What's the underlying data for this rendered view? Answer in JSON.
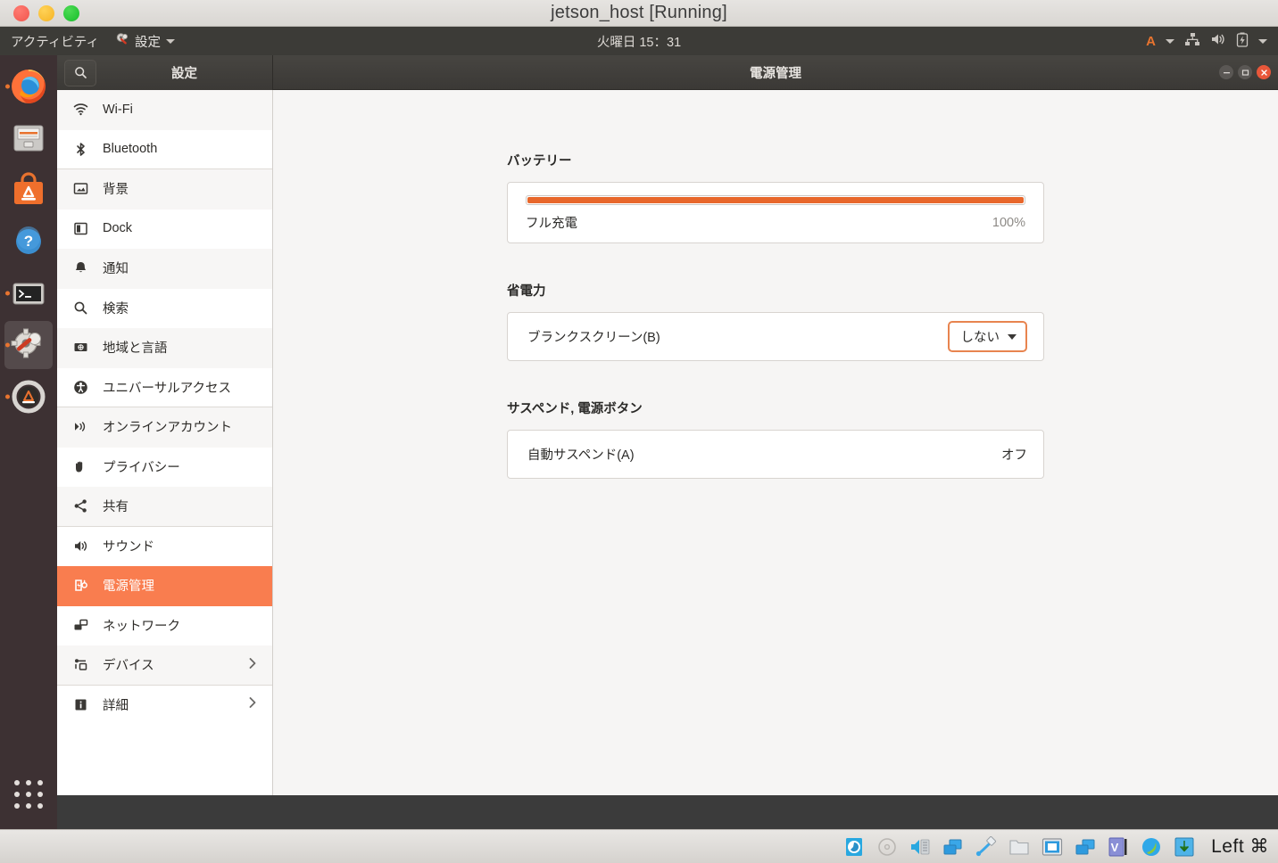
{
  "vm": {
    "title": "jetson_host [Running]",
    "statusbar": {
      "icons": [
        "hard-disk-icon",
        "optical-disk-icon",
        "audio-icon",
        "network-icon",
        "usb-icon",
        "shared-folder-icon",
        "display-icon",
        "recording-icon",
        "virtualbox-logo-icon",
        "updates-icon"
      ],
      "host_key": "Left ⌘"
    },
    "window_controls": [
      "minimize",
      "maximize",
      "close"
    ]
  },
  "topbar": {
    "activities": "アクティビティ",
    "app_name": "設定",
    "clock": "火曜日 15：31",
    "indicators": {
      "input_source": "A",
      "icons": [
        "network-icon",
        "volume-icon",
        "battery-charging-icon"
      ]
    }
  },
  "dock": {
    "items": [
      {
        "name": "firefox",
        "running": true,
        "active": false
      },
      {
        "name": "files",
        "running": false,
        "active": false
      },
      {
        "name": "ubuntu-software",
        "running": false,
        "active": false
      },
      {
        "name": "help",
        "running": false,
        "active": false
      },
      {
        "name": "terminal",
        "running": true,
        "active": false
      },
      {
        "name": "settings",
        "running": true,
        "active": true
      },
      {
        "name": "software-updater",
        "running": true,
        "active": false
      }
    ],
    "show_apps_label": "show-applications"
  },
  "settings": {
    "sidebar_title": "設定",
    "page_title": "電源管理",
    "search_placeholder": "検索",
    "items": [
      {
        "label": "Wi-Fi",
        "icon": "wifi-icon",
        "key": "wifi",
        "alt": true,
        "sep": false,
        "chevron": false,
        "selected": false
      },
      {
        "label": "Bluetooth",
        "icon": "bluetooth-icon",
        "key": "bluetooth",
        "alt": false,
        "sep": true,
        "chevron": false,
        "selected": false
      },
      {
        "label": "背景",
        "icon": "background-icon",
        "key": "background",
        "alt": true,
        "sep": false,
        "chevron": false,
        "selected": false
      },
      {
        "label": "Dock",
        "icon": "dock-icon",
        "key": "dock",
        "alt": false,
        "sep": false,
        "chevron": false,
        "selected": false
      },
      {
        "label": "通知",
        "icon": "bell-icon",
        "key": "notifications",
        "alt": true,
        "sep": false,
        "chevron": false,
        "selected": false
      },
      {
        "label": "検索",
        "icon": "search-icon",
        "key": "search",
        "alt": false,
        "sep": false,
        "chevron": false,
        "selected": false
      },
      {
        "label": "地域と言語",
        "icon": "language-icon",
        "key": "region",
        "alt": true,
        "sep": false,
        "chevron": false,
        "selected": false
      },
      {
        "label": "ユニバーサルアクセス",
        "icon": "accessibility-icon",
        "key": "a11y",
        "alt": false,
        "sep": true,
        "chevron": false,
        "selected": false
      },
      {
        "label": "オンラインアカウント",
        "icon": "online-accounts-icon",
        "key": "online",
        "alt": true,
        "sep": false,
        "chevron": false,
        "selected": false
      },
      {
        "label": "プライバシー",
        "icon": "privacy-hand-icon",
        "key": "privacy",
        "alt": false,
        "sep": false,
        "chevron": false,
        "selected": false
      },
      {
        "label": "共有",
        "icon": "sharing-icon",
        "key": "sharing",
        "alt": true,
        "sep": true,
        "chevron": false,
        "selected": false
      },
      {
        "label": "サウンド",
        "icon": "sound-icon",
        "key": "sound",
        "alt": false,
        "sep": false,
        "chevron": false,
        "selected": false
      },
      {
        "label": "電源管理",
        "icon": "power-icon",
        "key": "power",
        "alt": false,
        "sep": false,
        "chevron": false,
        "selected": true
      },
      {
        "label": "ネットワーク",
        "icon": "network-icon",
        "key": "network",
        "alt": false,
        "sep": false,
        "chevron": false,
        "selected": false
      },
      {
        "label": "デバイス",
        "icon": "devices-icon",
        "key": "devices",
        "alt": true,
        "sep": true,
        "chevron": true,
        "selected": false
      },
      {
        "label": "詳細",
        "icon": "details-icon",
        "key": "details",
        "alt": false,
        "sep": false,
        "chevron": false,
        "selected": false
      }
    ]
  },
  "power_page": {
    "battery": {
      "section_title": "バッテリー",
      "status": "フル充電",
      "percent_label": "100%",
      "percent_value": 100
    },
    "power_saving": {
      "section_title": "省電力",
      "blank_screen_label": "ブランクスクリーン(B)",
      "blank_screen_value": "しない"
    },
    "suspend": {
      "section_title": "サスペンド, 電源ボタン",
      "auto_suspend_label": "自動サスペンド(A)",
      "auto_suspend_value": "オフ"
    }
  },
  "colors": {
    "accent_orange": "#f97d4f",
    "bar_orange": "#e8672b",
    "focus_orange": "#e8844f",
    "dock_bg": "#3d3133",
    "topbar_bg": "#3c3b37"
  }
}
